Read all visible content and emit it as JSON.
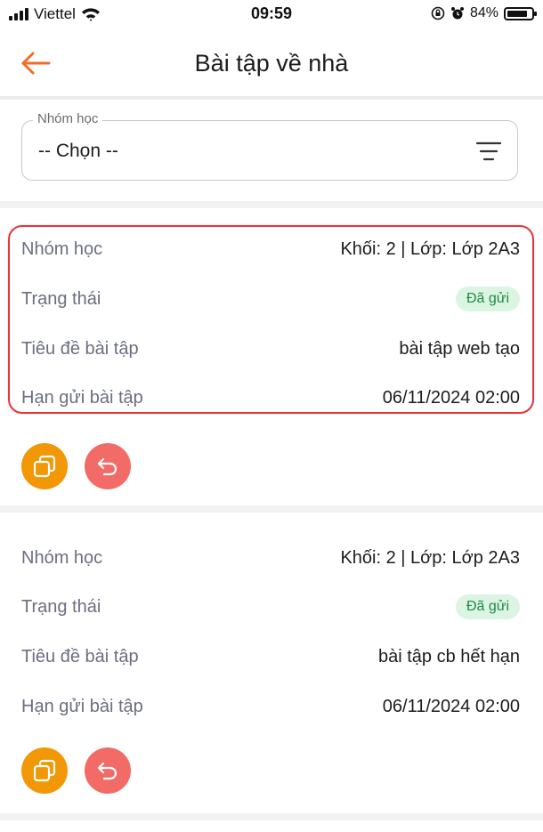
{
  "status_bar": {
    "carrier": "Viettel",
    "time": "09:59",
    "battery_percent": "84%",
    "battery_level": 0.84
  },
  "header": {
    "title": "Bài tập về nhà"
  },
  "filter": {
    "legend": "Nhóm học",
    "value": "-- Chọn --"
  },
  "cards": [
    {
      "group_label": "Nhóm học",
      "group_value": "Khối: 2 | Lớp: Lớp 2A3",
      "status_label": "Trạng thái",
      "status_value": "Đã gửi",
      "title_label": "Tiêu đề bài tập",
      "title_value": "bài tập web tạo",
      "deadline_label": "Hạn gửi bài tập",
      "deadline_value": "06/11/2024 02:00"
    },
    {
      "group_label": "Nhóm học",
      "group_value": "Khối: 2 | Lớp: Lớp 2A3",
      "status_label": "Trạng thái",
      "status_value": "Đã gửi",
      "title_label": "Tiêu đề bài tập",
      "title_value": "bài tập cb hết hạn",
      "deadline_label": "Hạn gửi bài tập",
      "deadline_value": "06/11/2024 02:00"
    }
  ],
  "colors": {
    "accent": "#f26b2a",
    "copy_button": "#f29705",
    "undo_button": "#f26b66",
    "badge_bg": "#dcf5e3",
    "badge_text": "#1f8a47",
    "highlight": "#e2373b"
  }
}
